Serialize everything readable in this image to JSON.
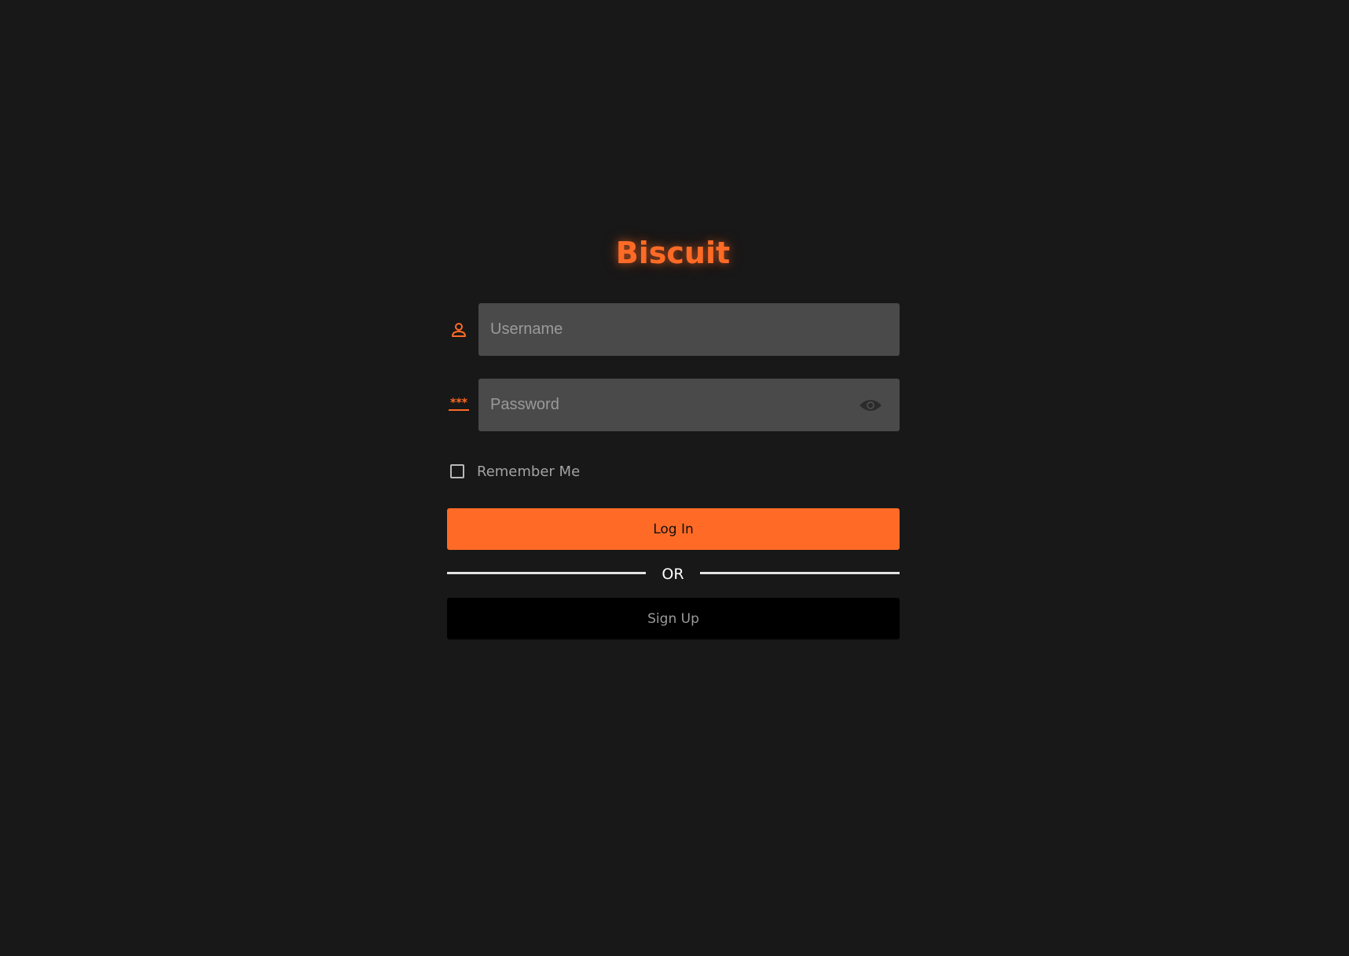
{
  "app": {
    "title": "Biscuit",
    "accent_color": "#ff6b26",
    "background_color": "#181818"
  },
  "login_form": {
    "username": {
      "icon": "user-icon",
      "placeholder": "Username",
      "value": ""
    },
    "password": {
      "icon": "password-icon",
      "placeholder": "Password",
      "value": "",
      "toggle_icon": "eye-icon"
    },
    "remember_me": {
      "label": "Remember Me",
      "checked": false
    },
    "login_button_label": "Log In",
    "divider_text": "OR",
    "signup_button_label": "Sign Up"
  }
}
